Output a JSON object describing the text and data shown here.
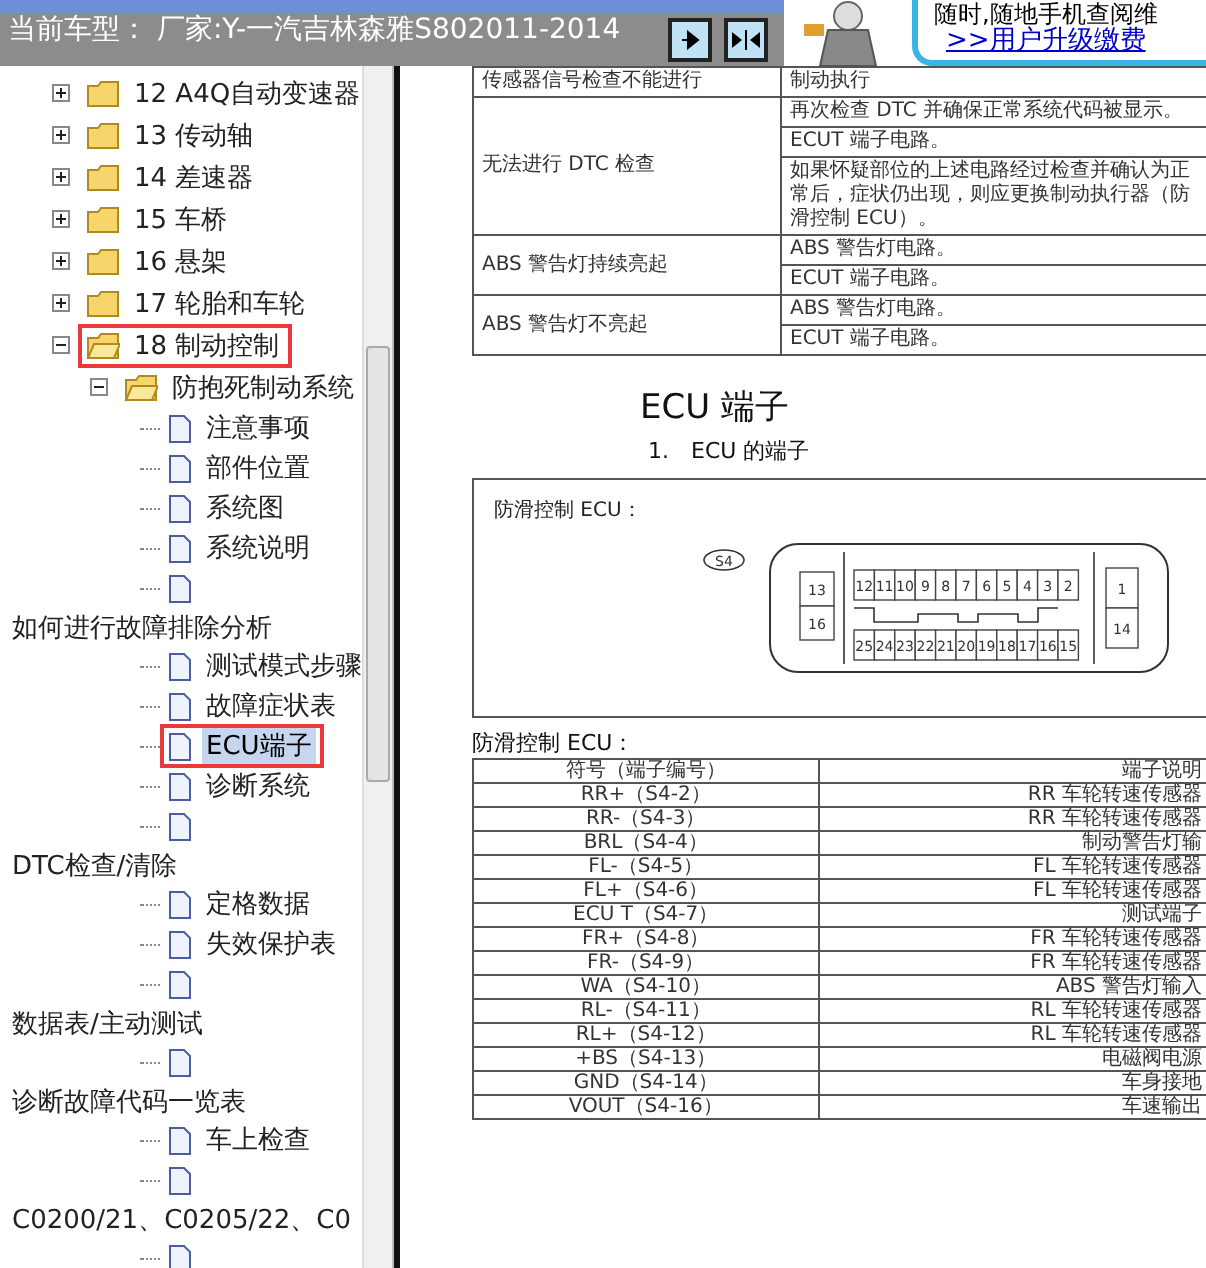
{
  "header": {
    "title": "当前车型： 厂家:Y-一汽吉林森雅S802011-2014",
    "ad_text": "随时,随地手机查阅维",
    "ad_link": ">>用户升级缴费"
  },
  "tree": [
    {
      "label": "12 A4Q自动变速器",
      "kind": "folder",
      "expanded": false,
      "outlined": false
    },
    {
      "label": "13 传动轴",
      "kind": "folder",
      "expanded": false,
      "outlined": false
    },
    {
      "label": "14 差速器",
      "kind": "folder",
      "expanded": false,
      "outlined": false
    },
    {
      "label": "15 车桥",
      "kind": "folder",
      "expanded": false,
      "outlined": false
    },
    {
      "label": "16 悬架",
      "kind": "folder",
      "expanded": false,
      "outlined": false
    },
    {
      "label": "17 轮胎和车轮",
      "kind": "folder",
      "expanded": false,
      "outlined": false
    },
    {
      "label": "18 制动控制",
      "kind": "folder",
      "expanded": true,
      "outlined": true,
      "children": [
        {
          "label": "防抱死制动系统",
          "kind": "folder",
          "expanded": true,
          "outlined": false,
          "children": [
            {
              "label": "注意事项",
              "kind": "page",
              "selected": false,
              "outlined": false
            },
            {
              "label": "部件位置",
              "kind": "page",
              "selected": false,
              "outlined": false
            },
            {
              "label": "系统图",
              "kind": "page",
              "selected": false,
              "outlined": false
            },
            {
              "label": "系统说明",
              "kind": "page",
              "selected": false,
              "outlined": false
            },
            {
              "kind": "page",
              "selected": false,
              "outlined": false
            },
            {
              "label": "如何进行故障排除分析",
              "kind": "section",
              "children": [
                {
                  "label": "测试模式步骤",
                  "kind": "page",
                  "selected": false,
                  "outlined": false
                },
                {
                  "label": "故障症状表",
                  "kind": "page",
                  "selected": false,
                  "outlined": false
                },
                {
                  "label": "ECU端子",
                  "kind": "page",
                  "selected": true,
                  "outlined": true
                },
                {
                  "label": "诊断系统",
                  "kind": "page",
                  "selected": false,
                  "outlined": false
                },
                {
                  "kind": "page",
                  "selected": false,
                  "outlined": false
                }
              ]
            },
            {
              "label": "DTC检查/清除",
              "kind": "section",
              "children": [
                {
                  "label": "定格数据",
                  "kind": "page",
                  "selected": false,
                  "outlined": false
                },
                {
                  "label": "失效保护表",
                  "kind": "page",
                  "selected": false,
                  "outlined": false
                },
                {
                  "kind": "page",
                  "selected": false,
                  "outlined": false
                }
              ]
            },
            {
              "label": "数据表/主动测试",
              "kind": "section",
              "children": [
                {
                  "kind": "page",
                  "selected": false,
                  "outlined": false
                }
              ]
            },
            {
              "label": "诊断故障代码一览表",
              "kind": "section",
              "children": [
                {
                  "label": "车上检查",
                  "kind": "page",
                  "selected": false,
                  "outlined": false
                },
                {
                  "kind": "page",
                  "selected": false,
                  "outlined": false
                }
              ]
            },
            {
              "label": "C0200/21、C0205/22、C0",
              "kind": "section",
              "children": [
                {
                  "kind": "page",
                  "selected": false,
                  "outlined": false
                }
              ]
            }
          ]
        }
      ]
    }
  ],
  "fault_table": [
    {
      "symptom": "传感器信号检查不能进行",
      "checks": [
        "制动执行"
      ]
    },
    {
      "symptom": "无法进行 DTC 检查",
      "checks": [
        "再次检查 DTC 并确保正常系统代码被显示。",
        "ECUT 端子电路。",
        "如果怀疑部位的上述电路经过检查并确认为正常后，症状仍出现，则应更换制动执行器（防滑控制 ECU）。"
      ]
    },
    {
      "symptom": "ABS 警告灯持续亮起",
      "checks": [
        "ABS 警告灯电路。",
        "ECUT 端子电路。"
      ]
    },
    {
      "symptom": "ABS 警告灯不亮起",
      "checks": [
        "ABS 警告灯电路。",
        "ECUT 端子电路。"
      ]
    }
  ],
  "section_title": "ECU 端子",
  "subsection_title": "1.　ECU 的端子",
  "connector_box": {
    "caption": "防滑控制 ECU：",
    "connector": "S4",
    "left_pins": [
      "13",
      "16"
    ],
    "top_pins": [
      "12",
      "11",
      "10",
      "9",
      "8",
      "7",
      "6",
      "5",
      "4",
      "3",
      "2"
    ],
    "bottom_pins": [
      "25",
      "24",
      "23",
      "22",
      "21",
      "20",
      "19",
      "18",
      "17",
      "16",
      "15"
    ],
    "right_pins": [
      "1",
      "14"
    ]
  },
  "terminal_table": {
    "caption": "防滑控制 ECU：",
    "columns": [
      "符号（端子编号）",
      "端子说明"
    ],
    "rows": [
      {
        "symbol": "RR+（S4-2）",
        "description": "RR 车轮转速传感器"
      },
      {
        "symbol": "RR-（S4-3）",
        "description": "RR 车轮转速传感器"
      },
      {
        "symbol": "BRL（S4-4）",
        "description": "制动警告灯输"
      },
      {
        "symbol": "FL-（S4-5）",
        "description": "FL 车轮转速传感器"
      },
      {
        "symbol": "FL+（S4-6）",
        "description": "FL 车轮转速传感器"
      },
      {
        "symbol": "ECU T（S4-7）",
        "description": "测试端子"
      },
      {
        "symbol": "FR+（S4-8）",
        "description": "FR 车轮转速传感器"
      },
      {
        "symbol": "FR-（S4-9）",
        "description": "FR 车轮转速传感器"
      },
      {
        "symbol": "WA（S4-10）",
        "description": "ABS 警告灯输入"
      },
      {
        "symbol": "RL-（S4-11）",
        "description": "RL 车轮转速传感器"
      },
      {
        "symbol": "RL+（S4-12）",
        "description": "RL 车轮转速传感器"
      },
      {
        "symbol": "+BS（S4-13）",
        "description": "电磁阀电源"
      },
      {
        "symbol": "GND（S4-14）",
        "description": "车身接地"
      },
      {
        "symbol": "VOUT（S4-16）",
        "description": "车速输出"
      }
    ]
  }
}
